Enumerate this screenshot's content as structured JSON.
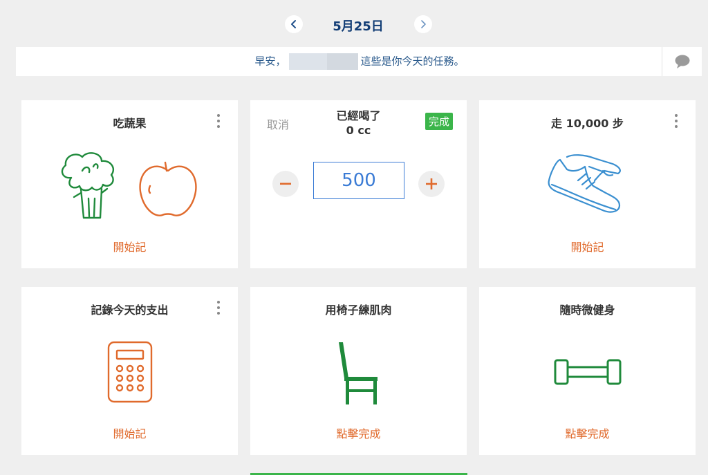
{
  "header": {
    "date": "5月25日",
    "prev_icon": "chevron-left-icon",
    "next_icon": "chevron-right-icon"
  },
  "greeting": {
    "prefix": "早安，",
    "suffix": "這些是你今天的任務。",
    "chat_icon": "chat-bubble-icon"
  },
  "cards": {
    "veg": {
      "title": "吃蔬果",
      "action": "開始記",
      "icons": [
        "broccoli-icon",
        "apple-icon"
      ]
    },
    "water": {
      "cancel": "取消",
      "title_line1": "已經喝了",
      "title_line2": "0 cc",
      "done": "完成",
      "amount": "500"
    },
    "steps": {
      "title": "走 10,000 步",
      "action": "開始記",
      "icon": "sneaker-icon"
    },
    "expense": {
      "title": "記錄今天的支出",
      "action": "開始記",
      "icon": "calculator-icon"
    },
    "chair": {
      "title": "用椅子練肌肉",
      "action": "點擊完成",
      "icon": "chair-icon"
    },
    "fitness": {
      "title": "隨時微健身",
      "action": "點擊完成",
      "icon": "dumbbell-icon"
    }
  },
  "colors": {
    "accent_orange": "#e06a2c",
    "green": "#1f8a3b",
    "blue": "#3a8fd0",
    "date_blue": "#123d75",
    "done_green": "#3bb54a"
  }
}
